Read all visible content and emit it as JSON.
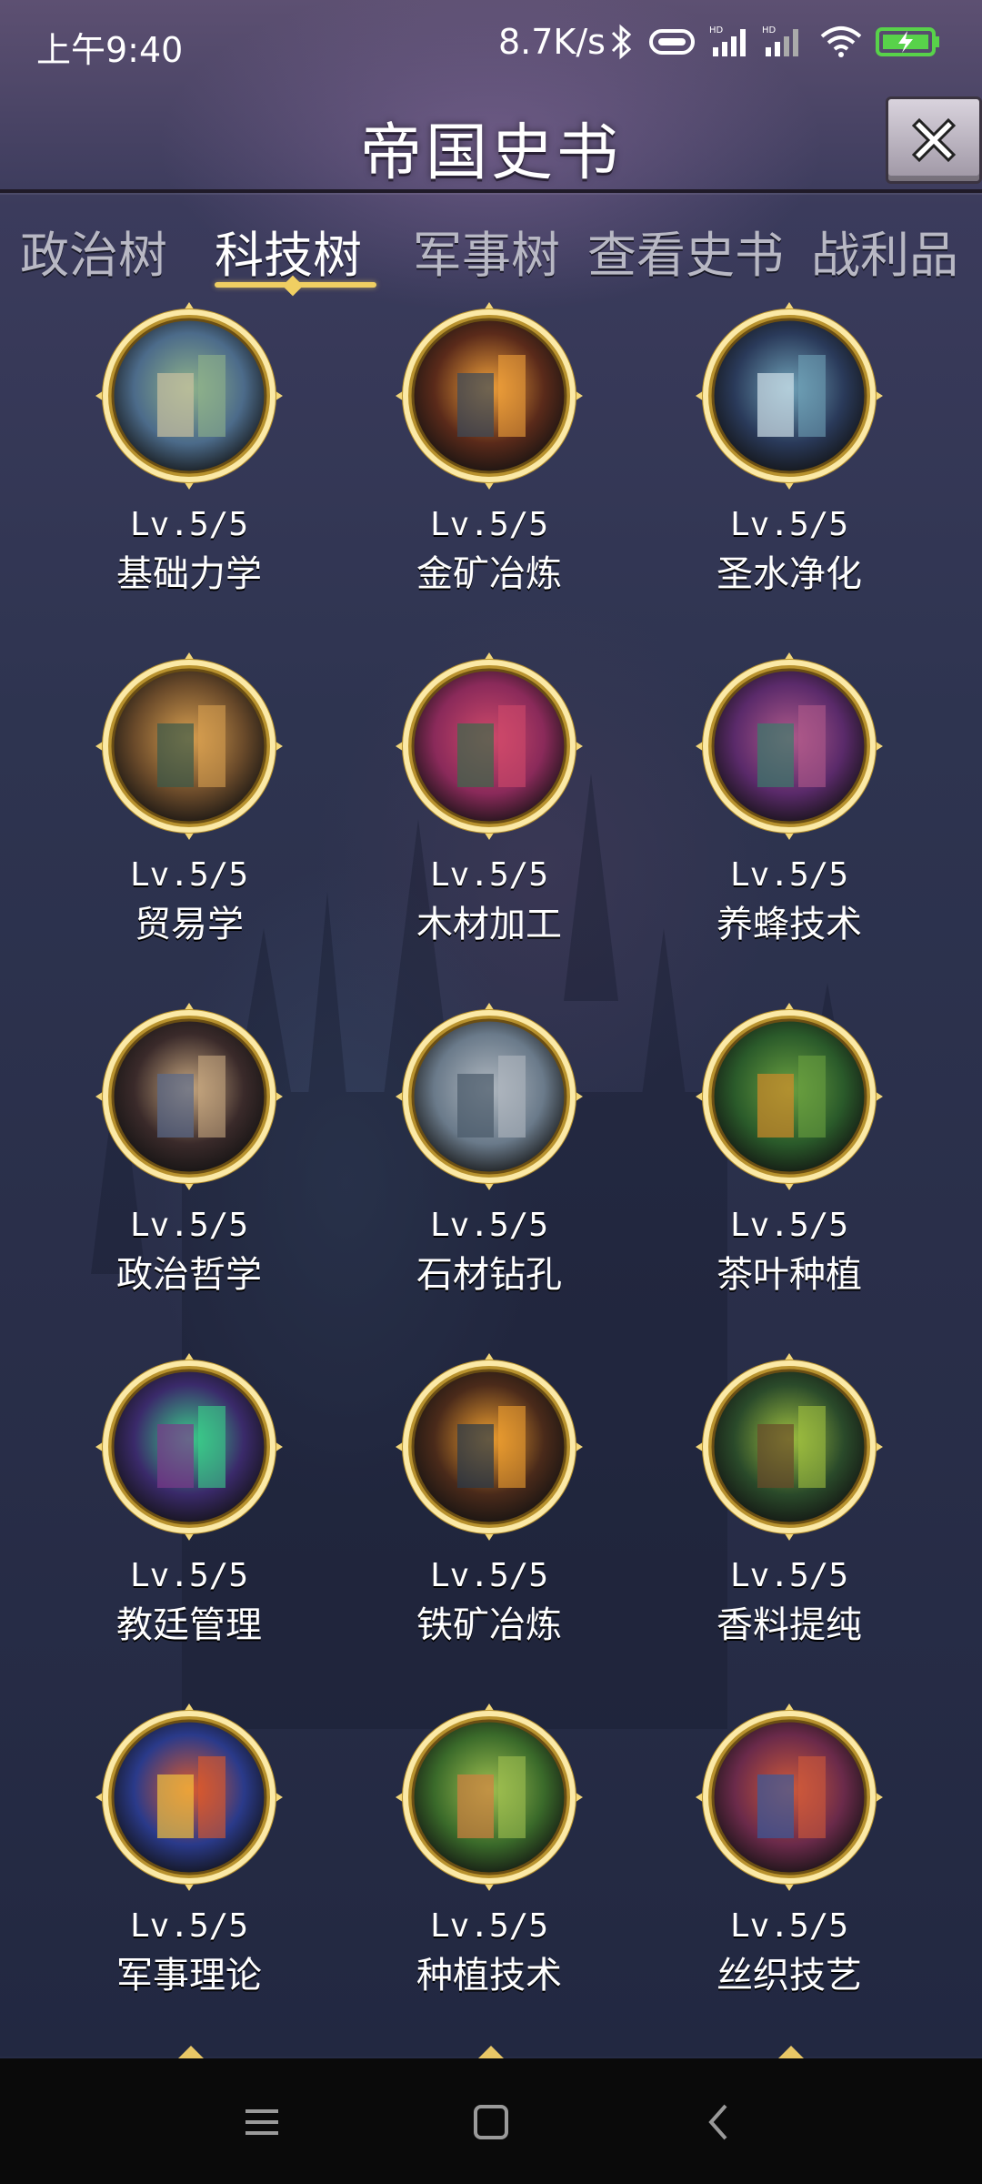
{
  "status_bar": {
    "time": "上午9:40",
    "speed": "8.7K/s",
    "icons": [
      "bluetooth-icon",
      "vibrate-icon",
      "hd-signal-icon",
      "hd-signal-icon",
      "wifi-icon",
      "battery-charging-icon"
    ],
    "battery_color": "#58d24a"
  },
  "header": {
    "title": "帝国史书",
    "close_icon": "close-x-icon"
  },
  "tabs": [
    {
      "label": "政治树",
      "active": false
    },
    {
      "label": "科技树",
      "active": true
    },
    {
      "label": "军事树",
      "active": false
    },
    {
      "label": "查看史书",
      "active": false
    },
    {
      "label": "战利品",
      "active": false
    }
  ],
  "accent_color": "#f0cf62",
  "techs": [
    {
      "level": "Lv.5/5",
      "name": "基础力学",
      "icon": "statue-mechanics-icon"
    },
    {
      "level": "Lv.5/5",
      "name": "金矿冶炼",
      "icon": "furnace-icon"
    },
    {
      "level": "Lv.5/5",
      "name": "圣水净化",
      "icon": "shrine-icon"
    },
    {
      "level": "Lv.5/5",
      "name": "贸易学",
      "icon": "market-icon"
    },
    {
      "level": "Lv.5/5",
      "name": "木材加工",
      "icon": "forest-icon"
    },
    {
      "level": "Lv.5/5",
      "name": "养蜂技术",
      "icon": "beehive-icon"
    },
    {
      "level": "Lv.5/5",
      "name": "政治哲学",
      "icon": "philosopher-icon"
    },
    {
      "level": "Lv.5/5",
      "name": "石材钻孔",
      "icon": "drill-icon"
    },
    {
      "level": "Lv.5/5",
      "name": "茶叶种植",
      "icon": "tea-plant-icon"
    },
    {
      "level": "Lv.5/5",
      "name": "教廷管理",
      "icon": "priests-icon"
    },
    {
      "level": "Lv.5/5",
      "name": "铁矿冶炼",
      "icon": "forge-icon"
    },
    {
      "level": "Lv.5/5",
      "name": "香料提纯",
      "icon": "spice-icon"
    },
    {
      "level": "Lv.5/5",
      "name": "军事理论",
      "icon": "knight-icon"
    },
    {
      "level": "Lv.5/5",
      "name": "种植技术",
      "icon": "farm-icon"
    },
    {
      "level": "Lv.5/5",
      "name": "丝织技艺",
      "icon": "silk-town-icon"
    }
  ],
  "nav_bar": {
    "buttons": [
      "menu-icon",
      "home-icon",
      "back-icon"
    ]
  }
}
